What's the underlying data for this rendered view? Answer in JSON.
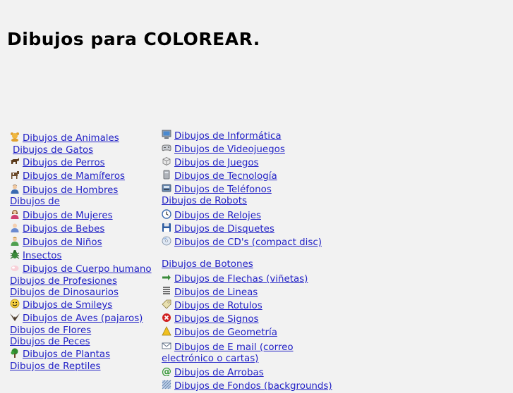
{
  "page": {
    "title": "Dibujos para COLOREAR."
  },
  "left": {
    "animales": "Dibujos de Animales",
    "gatos": "Dibujos de Gatos",
    "perros": "Dibujos de Perros",
    "mamiferos": "Dibujos de Mamíferos",
    "hombres": "Dibujos de Hombres",
    "de_partial": "Dibujos de ",
    "mujeres": "Dibujos de Mujeres",
    "bebes": "Dibujos de Bebes",
    "ninos": "Dibujos de Niños",
    "insectos": "Insectos",
    "cuerpo": "Dibujos de Cuerpo humano",
    "profesiones": "Dibujos de Profesiones",
    "dinosaurios": "Dibujos de Dinosaurios",
    "smileys": "Dibujos de Smileys",
    "aves": "Dibujos de Aves (pajaros)",
    "flores": "Dibujos de Flores",
    "peces": "Dibujos de Peces",
    "plantas": "Dibujos de Plantas",
    "reptiles": "Dibujos de Reptiles"
  },
  "right": {
    "informatica": "Dibujos de Informática",
    "videojuegos": "Dibujos de Videojuegos",
    "juegos": "Dibujos de Juegos",
    "tecnologia": "Dibujos de Tecnología",
    "telefonos": "Dibujos de Teléfonos",
    "robots": "Dibujos de Robots",
    "relojes": "Dibujos de Relojes",
    "disquetes": "Dibujos de Disquetes",
    "cds": "Dibujos de CD's (compact disc)",
    "botones": "Dibujos de Botones",
    "flechas": "Dibujos de Flechas (viñetas)",
    "lineas": "Dibujos de Lineas",
    "rotulos": "Dibujos de Rotulos",
    "signos": "Dibujos de Signos",
    "geometria": "Dibujos de Geometría",
    "email": "Dibujos de E mail (correo electrónico o cartas)",
    "arrobas": "Dibujos de Arrobas",
    "fondos": "Dibujos de Fondos (backgrounds)"
  }
}
